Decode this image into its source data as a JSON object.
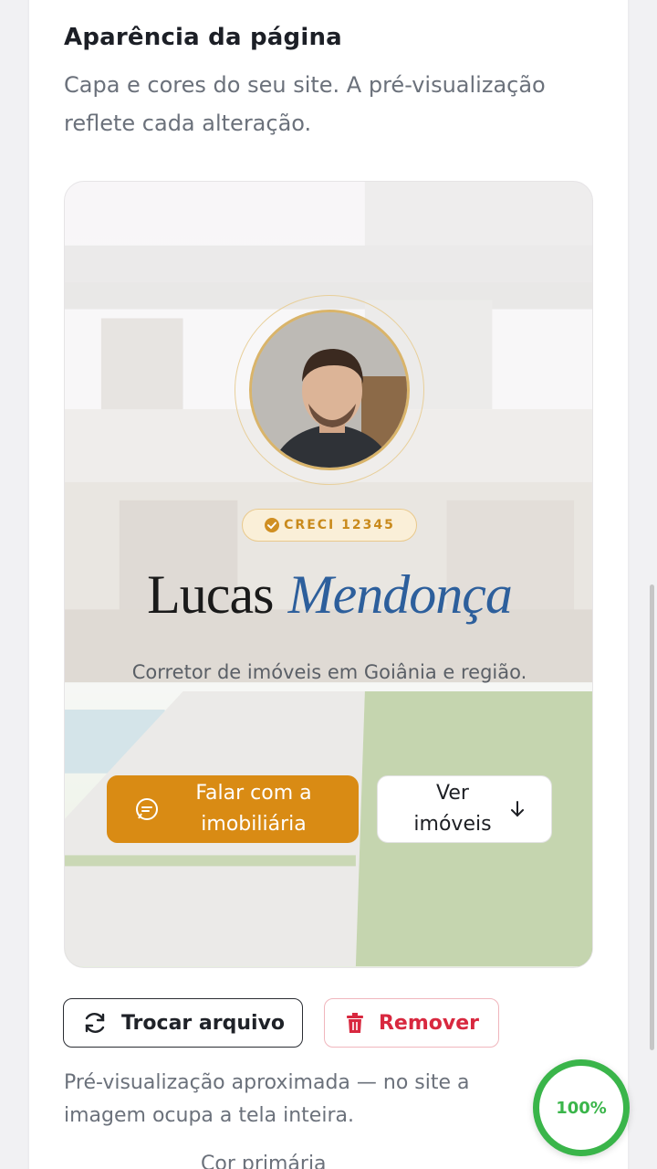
{
  "section": {
    "title": "Aparência da página",
    "description": "Capa e cores do seu site. A pré-visualização reflete cada alteração."
  },
  "preview": {
    "creci": "CRECI 12345",
    "name_first": "Lucas",
    "name_last": "Mendonça",
    "tagline": "Corretor de imóveis em Goiânia e região.",
    "primary_button": "Falar com a imobiliária",
    "secondary_button": "Ver imóveis"
  },
  "actions": {
    "replace_label": "Trocar arquivo",
    "remove_label": "Remover"
  },
  "note": "Pré-visualização aproximada — no site a imagem ocupa a tela inteira.",
  "next_field_label": "Cor primária",
  "progress": {
    "label": "100%",
    "value": 1.0
  },
  "colors": {
    "accent": "#d98b14",
    "name_highlight": "#2d5f9c",
    "danger": "#d8283f",
    "progress": "#3ab54a"
  },
  "icons": {
    "verified": "badge-check-icon",
    "chat": "chat-bubble-icon",
    "arrow": "arrow-down-icon",
    "refresh": "refresh-icon",
    "trash": "trash-icon"
  }
}
